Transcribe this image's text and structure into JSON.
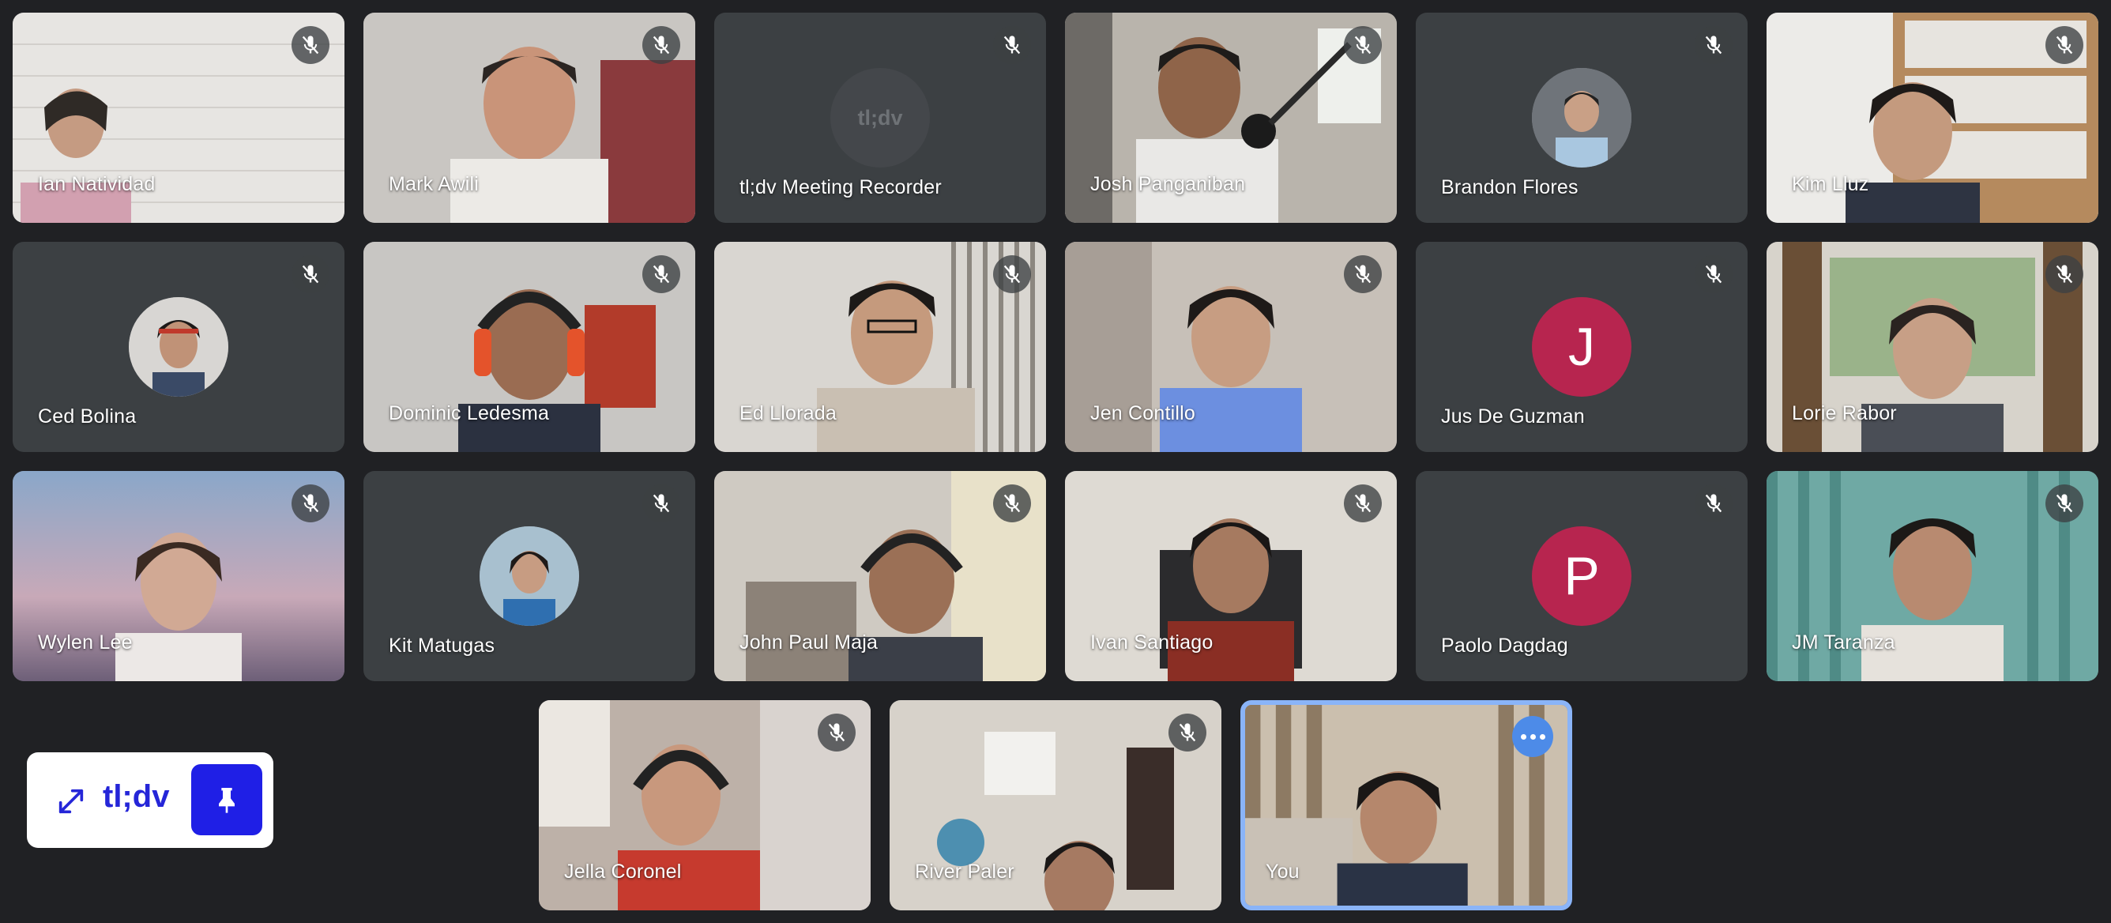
{
  "participants": [
    {
      "name": "Ian Natividad"
    },
    {
      "name": "Mark Awili"
    },
    {
      "name": "tl;dv Meeting Recorder",
      "avatar_text": "tl;dv"
    },
    {
      "name": "Josh Panganiban"
    },
    {
      "name": "Brandon Flores"
    },
    {
      "name": "Kim Lluz"
    },
    {
      "name": "Ced Bolina"
    },
    {
      "name": "Dominic Ledesma"
    },
    {
      "name": "Ed Llorada"
    },
    {
      "name": "Jen Contillo"
    },
    {
      "name": "Jus De Guzman",
      "avatar_letter": "J"
    },
    {
      "name": "Lorie Rabor"
    },
    {
      "name": "Wylen Lee"
    },
    {
      "name": "Kit Matugas"
    },
    {
      "name": "John Paul Maja"
    },
    {
      "name": "Ivan Santiago"
    },
    {
      "name": "Paolo Dagdag",
      "avatar_letter": "P"
    },
    {
      "name": "JM Taranza"
    },
    {
      "name": "Jella Coronel"
    },
    {
      "name": "River Paler"
    },
    {
      "name": "You"
    }
  ],
  "widget": {
    "brand": "tl;dv",
    "expand_icon": "expand-icon",
    "pin_icon": "pin-icon"
  },
  "colors": {
    "background": "#202124",
    "avatar_letter_bg": "#b7254f",
    "brand": "#2526d8",
    "self_border": "#8ab4f8"
  }
}
